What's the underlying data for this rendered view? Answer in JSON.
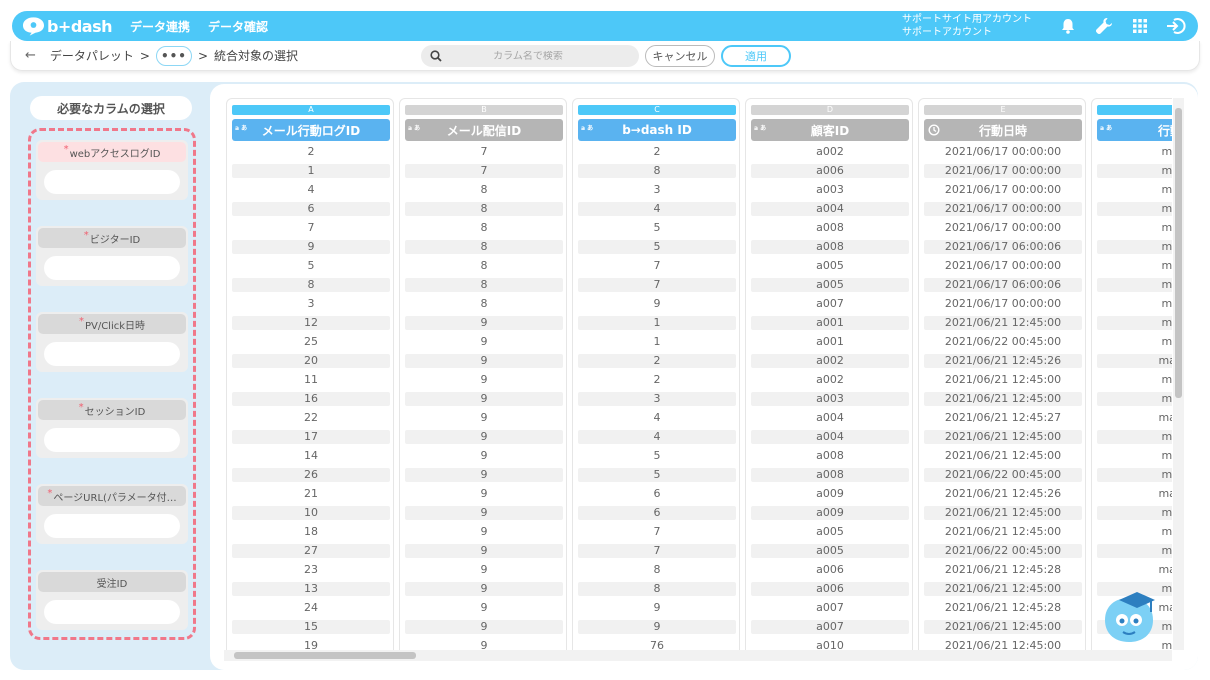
{
  "app": {
    "logo": "b+dash"
  },
  "nav": [
    "データ連携",
    "データ確認"
  ],
  "account": {
    "line1": "サポートサイト用アカウント",
    "line2": "サポートアカウント"
  },
  "breadcrumb": {
    "item1": "データパレット",
    "sep": ">",
    "dots": "•••",
    "current": "統合対象の選択"
  },
  "search": {
    "placeholder": "カラム名で検索"
  },
  "buttons": {
    "cancel": "キャンセル",
    "apply": "適用"
  },
  "left_panel": {
    "title": "必要なカラムの選択",
    "slots": [
      {
        "label": "webアクセスログID",
        "required": true,
        "active": true
      },
      {
        "label": "ビジターID",
        "required": true,
        "active": false
      },
      {
        "label": "PV/Click日時",
        "required": true,
        "active": false
      },
      {
        "label": "セッションID",
        "required": true,
        "active": false
      },
      {
        "label": "ページURL(パラメータ付…",
        "required": true,
        "active": false
      },
      {
        "label": "受注ID",
        "required": false,
        "active": false
      }
    ],
    "required_mark": "*"
  },
  "colors": {
    "accent": "#4dc8f8",
    "header_blue": "#5ab3f0",
    "header_gray": "#b5b5b5",
    "dash": "#f0788a"
  },
  "table": {
    "columns": [
      {
        "letter": "A",
        "type": "a/あ",
        "name": "メール行動ログID",
        "selected": true,
        "cells": [
          "2",
          "1",
          "4",
          "6",
          "7",
          "9",
          "5",
          "8",
          "3",
          "12",
          "25",
          "20",
          "11",
          "16",
          "22",
          "17",
          "14",
          "26",
          "21",
          "10",
          "18",
          "27",
          "23",
          "13",
          "24",
          "15",
          "19"
        ]
      },
      {
        "letter": "B",
        "type": "a/あ",
        "name": "メール配信ID",
        "selected": false,
        "cells": [
          "7",
          "7",
          "8",
          "8",
          "8",
          "8",
          "8",
          "8",
          "8",
          "9",
          "9",
          "9",
          "9",
          "9",
          "9",
          "9",
          "9",
          "9",
          "9",
          "9",
          "9",
          "9",
          "9",
          "9",
          "9",
          "9",
          "9"
        ]
      },
      {
        "letter": "C",
        "type": "a/あ",
        "name": "b→dash ID",
        "selected": true,
        "cells": [
          "2",
          "8",
          "3",
          "4",
          "5",
          "5",
          "7",
          "7",
          "9",
          "1",
          "1",
          "2",
          "2",
          "3",
          "4",
          "4",
          "5",
          "5",
          "6",
          "6",
          "7",
          "7",
          "8",
          "8",
          "9",
          "9",
          "76"
        ]
      },
      {
        "letter": "D",
        "type": "a/あ",
        "name": "顧客ID",
        "selected": false,
        "cells": [
          "a002",
          "a006",
          "a003",
          "a004",
          "a008",
          "a008",
          "a005",
          "a005",
          "a007",
          "a001",
          "a001",
          "a002",
          "a002",
          "a003",
          "a004",
          "a004",
          "a008",
          "a008",
          "a009",
          "a009",
          "a005",
          "a005",
          "a006",
          "a006",
          "a007",
          "a007",
          "a010"
        ]
      },
      {
        "letter": "E",
        "type": "clock",
        "name": "行動日時",
        "selected": false,
        "cells": [
          "2021/06/17 00:00:00",
          "2021/06/17 00:00:00",
          "2021/06/17 00:00:00",
          "2021/06/17 00:00:00",
          "2021/06/17 00:00:00",
          "2021/06/17 06:00:06",
          "2021/06/17 00:00:00",
          "2021/06/17 06:00:06",
          "2021/06/17 00:00:00",
          "2021/06/21 12:45:00",
          "2021/06/22 00:45:00",
          "2021/06/21 12:45:26",
          "2021/06/21 12:45:00",
          "2021/06/21 12:45:00",
          "2021/06/21 12:45:27",
          "2021/06/21 12:45:00",
          "2021/06/21 12:45:00",
          "2021/06/22 00:45:00",
          "2021/06/21 12:45:26",
          "2021/06/21 12:45:00",
          "2021/06/21 12:45:00",
          "2021/06/22 00:45:00",
          "2021/06/21 12:45:28",
          "2021/06/21 12:45:00",
          "2021/06/21 12:45:28",
          "2021/06/21 12:45:00",
          "2021/06/21 12:45:00"
        ]
      },
      {
        "letter": "",
        "type": "a/あ",
        "name": "行動分",
        "selected": true,
        "cells": [
          "mail_",
          "mail_",
          "mail_",
          "mail_",
          "mail_",
          "mail_",
          "mail_",
          "mail_",
          "mail_",
          "mail_",
          "mail_",
          "mail_c",
          "mail_",
          "mail_",
          "mail_c",
          "mail_",
          "mail_",
          "mail_",
          "mail_c",
          "mail_",
          "mail_",
          "mail_",
          "mail_c",
          "mail_",
          "mail_c",
          "mail_",
          "mail_"
        ]
      }
    ]
  }
}
